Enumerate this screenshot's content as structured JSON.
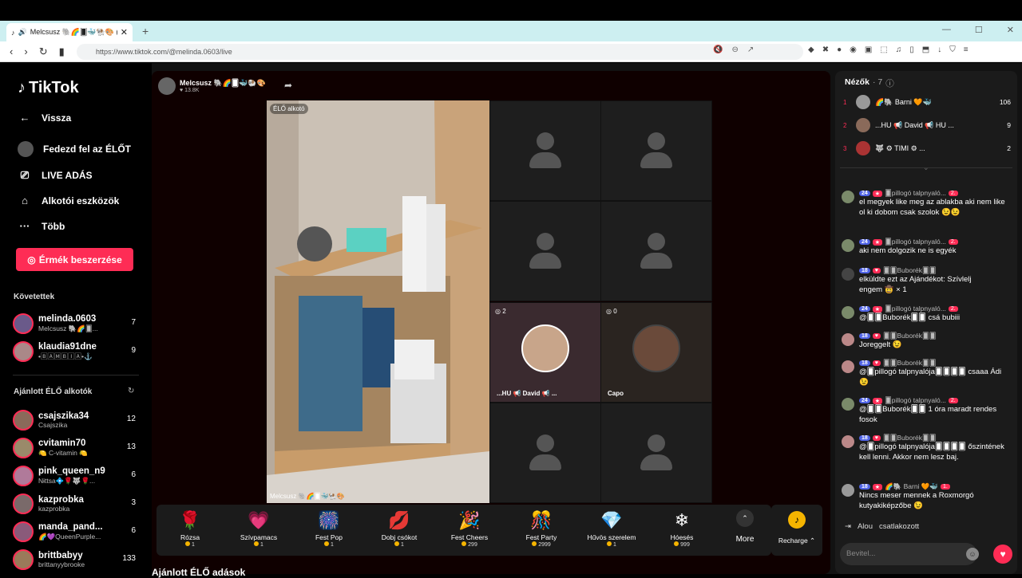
{
  "browser": {
    "tab_title": "Melcsusz 🐘🌈🂠🐳🐏🎨 (@",
    "new_tab": "+",
    "url": "https://www.tiktok.com/@melinda.0603/live"
  },
  "sidebar": {
    "logo": "TikTok",
    "back": "Vissza",
    "discover": "Fedezd fel az ÉLŐT",
    "live": "LIVE ADÁS",
    "creator_tools": "Alkotói eszközök",
    "more": "Több",
    "coins_button": "Érmék beszerzése",
    "following_title": "Követettek",
    "following": [
      {
        "name": "melinda.0603",
        "sub": "Melcsusz 🐘🌈🂠...",
        "count": "7"
      },
      {
        "name": "klaudia91dne",
        "sub": "•🄱🄰🄼🄱🄸🄰•⚓",
        "count": "9"
      }
    ],
    "suggested_title": "Ajánlott ÉLŐ alkotók",
    "suggested": [
      {
        "name": "csajszika34",
        "sub": "Csajszika",
        "count": "12"
      },
      {
        "name": "cvitamin70",
        "sub": "🍋 C-vitamin 🍋",
        "count": "13"
      },
      {
        "name": "pink_queen_n9",
        "sub": "Nɨttsa💠🌹🐺🌹...",
        "count": "6"
      },
      {
        "name": "kazprobka",
        "sub": "kazprobka",
        "count": "3"
      },
      {
        "name": "manda_pand...",
        "sub": "🌈💜QueenPurple...",
        "count": "6"
      },
      {
        "name": "brittbabyy",
        "sub": "brittanyybrooke",
        "count": "133"
      }
    ]
  },
  "stream": {
    "host_name": "Melcsusz 🐘🌈🂠🐳🐏🎨",
    "host_likes": "13.8K",
    "elo_tag": "ÉLŐ alkotó",
    "host_tag": "Melcsusz 🐘🌈🂠🐳🐏🎨",
    "guests": [
      {
        "name": "...HU 📢 David 📢 ...",
        "count": "2"
      },
      {
        "name": "Capo",
        "count": "0"
      }
    ],
    "bottom_title": "Ajánlott ÉLŐ adások"
  },
  "gifts": [
    {
      "name": "Rózsa",
      "price": "1",
      "icon": "🌹"
    },
    {
      "name": "Szívpamacs",
      "price": "1",
      "icon": "💗"
    },
    {
      "name": "Fest Pop",
      "price": "1",
      "icon": "🎆"
    },
    {
      "name": "Dobj csókot",
      "price": "1",
      "icon": "💋"
    },
    {
      "name": "Fest Cheers",
      "price": "299",
      "icon": "🎉"
    },
    {
      "name": "Fest Party",
      "price": "2999",
      "icon": "🎊"
    },
    {
      "name": "Hűvös szerelem",
      "price": "1",
      "icon": "💎"
    },
    {
      "name": "Hóesés",
      "price": "999",
      "icon": "❄"
    }
  ],
  "gift_more": "More",
  "recharge": "Recharge",
  "panel": {
    "viewers_title": "Nézők",
    "viewers_count": "· 7",
    "viewers": [
      {
        "rank": "1",
        "name": "🌈🐘 Barni 🧡🐳",
        "score": "106"
      },
      {
        "rank": "2",
        "name": "...HU 📢 David 📢 HU ...",
        "score": "9"
      },
      {
        "rank": "3",
        "name": "🐺 ⚙ TIMI ⚙ ...",
        "score": "2"
      }
    ],
    "chat": [
      {
        "level": "24",
        "user": "🂠pillogó talpnyaló...",
        "rank": "2.",
        "text": "el megyek like meg az ablakba aki nem like ol ki dobom csak szolok 😉😉"
      },
      {
        "level": "24",
        "user": "🂠pillogó talpnyaló...",
        "rank": "2.",
        "text": "aki nem dolgozik ne is egyék"
      },
      {
        "level": "18",
        "user": "🂠🂠Buborék🂠🂠",
        "rank": "",
        "text": "elküldte ezt az Ajándékot: Szívlelj engem 🤠 × 1"
      },
      {
        "level": "24",
        "user": "🂠pillogó talpnyaló...",
        "rank": "2.",
        "text": "@🂠🂠Buborék🂠🂠 csá bubiii"
      },
      {
        "level": "18",
        "user": "🂠🂠Buborék🂠🂠",
        "rank": "",
        "text": "Joreggelt 😉"
      },
      {
        "level": "18",
        "user": "🂠🂠Buborék🂠🂠",
        "rank": "",
        "text": "@🂠pillogó talpnyalója🂠🂠🂠🂠 csaaa Ádi 😉"
      },
      {
        "level": "24",
        "user": "🂠pillogó talpnyaló...",
        "rank": "2.",
        "text": "@🂠🂠Buborék🂠🂠 1 óra maradt rendes fosok"
      },
      {
        "level": "18",
        "user": "🂠🂠Buborék🂠🂠",
        "rank": "",
        "text": "@🂠pillogó talpnyalója🂠🂠🂠🂠 őszintének kell lenni. Akkor nem lesz baj."
      },
      {
        "level": "18",
        "user": "🌈🐘 Barni 🧡🐳",
        "rank": "1.",
        "text": "Nincs meser mennek a Roxmorgó kutyakiképzőbe 😉"
      }
    ],
    "joined_user": "Alou",
    "joined_text": "csatlakozott",
    "input_placeholder": "Bevitel..."
  }
}
